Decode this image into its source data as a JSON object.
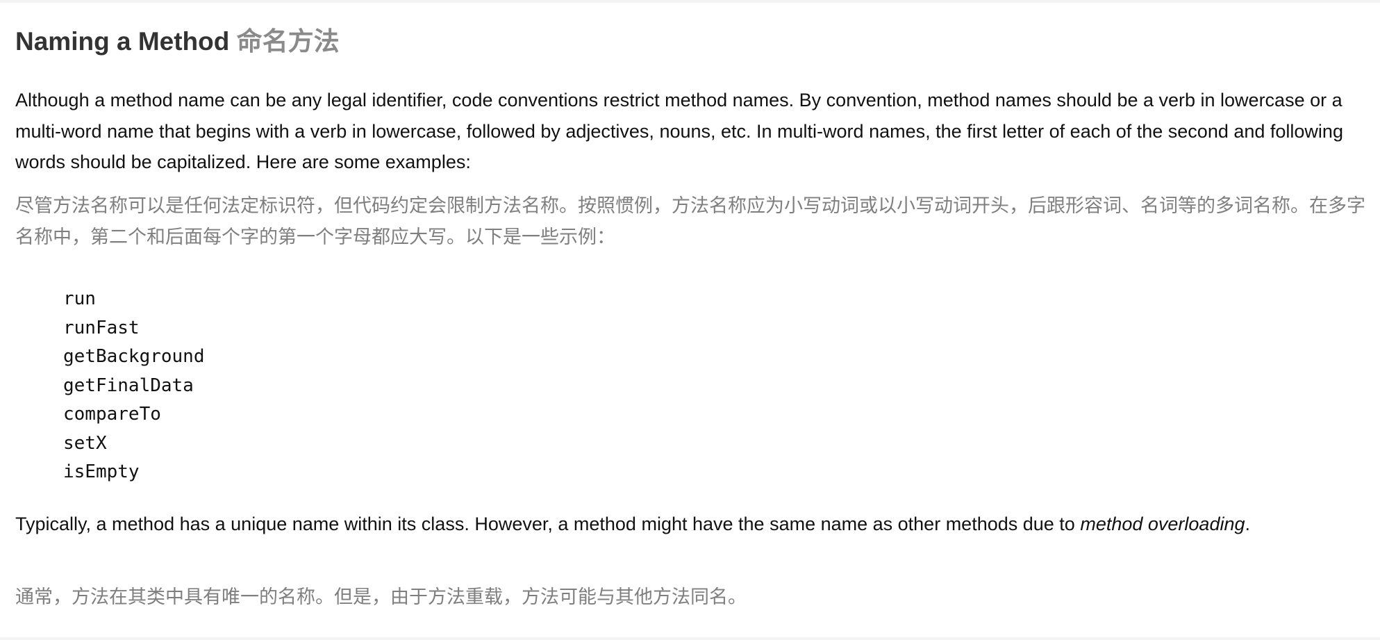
{
  "section": {
    "title_en": "Naming a Method",
    "title_zh": "命名方法"
  },
  "intro": {
    "en": "Although a method name can be any legal identifier, code conventions restrict method names. By convention, method names should be a verb in lowercase or a multi-word name that begins with a verb in lowercase, followed by adjectives, nouns, etc. In multi-word names, the first letter of each of the second and following words should be capitalized. Here are some examples:",
    "zh": "尽管方法名称可以是任何法定标识符，但代码约定会限制方法名称。按照惯例，方法名称应为小写动词或以小写动词开头，后跟形容词、名词等的多词名称。在多字名称中，第二个和后面每个字的第一个字母都应大写。以下是一些示例："
  },
  "examples": [
    "run",
    "runFast",
    "getBackground",
    "getFinalData",
    "compareTo",
    "setX",
    "isEmpty"
  ],
  "overloading": {
    "en_before": "Typically, a method has a unique name within its class. However, a method might have the same name as other methods due to ",
    "en_emphasis": "method overloading",
    "en_after": ".",
    "zh": "通常，方法在其类中具有唯一的名称。但是，由于方法重载，方法可能与其他方法同名。"
  }
}
